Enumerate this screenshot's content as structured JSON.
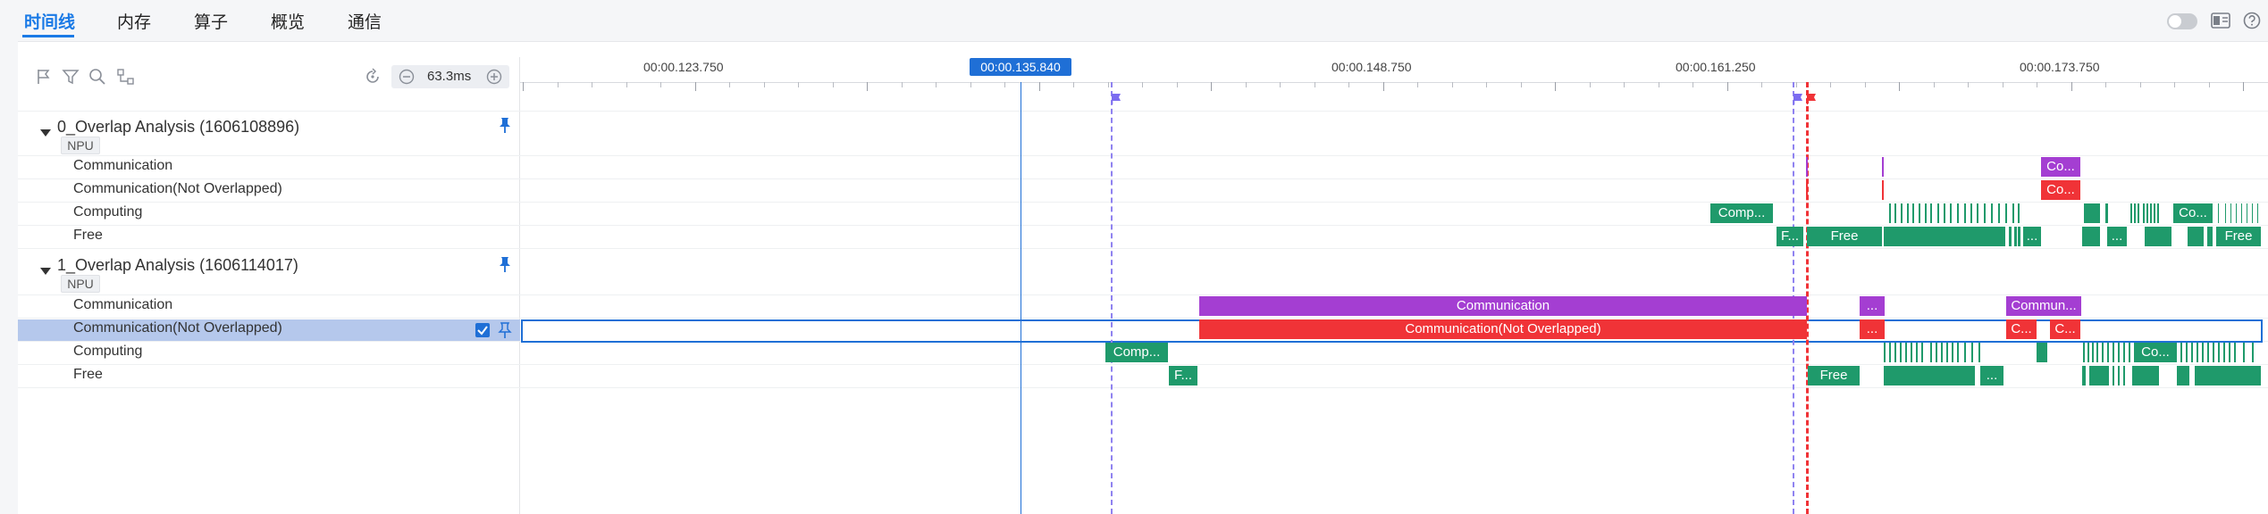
{
  "tabs": [
    {
      "label": "时间线",
      "active": true
    },
    {
      "label": "内存",
      "active": false
    },
    {
      "label": "算子",
      "active": false
    },
    {
      "label": "概览",
      "active": false
    },
    {
      "label": "通信",
      "active": false
    }
  ],
  "header_icons": [
    "toggle-switch",
    "settings-icon",
    "help-icon"
  ],
  "toolbar": {
    "icons": [
      "flag-icon",
      "filter-icon",
      "search-icon",
      "link-icon",
      "reset-icon"
    ],
    "zoom_out_icon": "zoom-out-icon",
    "zoom_in_icon": "zoom-in-icon",
    "zoom_level": "63.3ms"
  },
  "ruler": {
    "labels": [
      "00:00.123.750",
      "00:00.148.750",
      "00:00.161.250",
      "00:00.173.750"
    ],
    "cursor_time": "00:00.135.840"
  },
  "groups": [
    {
      "title": "0_Overlap Analysis (1606108896)",
      "badge": "NPU",
      "rows": [
        "Communication",
        "Communication(Not Overlapped)",
        "Computing",
        "Free"
      ]
    },
    {
      "title": "1_Overlap Analysis (1606114017)",
      "badge": "NPU",
      "rows": [
        "Communication",
        "Communication(Not Overlapped)",
        "Computing",
        "Free"
      ]
    }
  ],
  "selected_row": "Communication(Not Overlapped)",
  "slice_labels": {
    "g0_comm": "Co...",
    "g0_noov": "Co...",
    "g0_comp_a": "Comp...",
    "g0_comp_b": "Co...",
    "g0_free_a": "F...",
    "g0_free_b": "Free",
    "g0_free_c": "...",
    "g0_free_d": "...",
    "g0_free_e": "Free",
    "g1_comm_main": "Communication",
    "g1_comm_b": "...",
    "g1_comm_c": "Commun...",
    "g1_noov_main": "Communication(Not Overlapped)",
    "g1_noov_b": "...",
    "g1_noov_c": "C...",
    "g1_noov_d": "C...",
    "g1_comp_a": "Comp...",
    "g1_comp_b": "Co...",
    "g1_free_a": "F...",
    "g1_free_b": "Free",
    "g1_free_c": "..."
  },
  "colors": {
    "accent": "#1a7ae6",
    "communication": "#a43ed2",
    "not_overlapped": "#f03337",
    "computing": "#1f9a6b",
    "free": "#1f9a6b",
    "marker_purple": "#7b6cf0",
    "marker_red": "#f03337"
  }
}
